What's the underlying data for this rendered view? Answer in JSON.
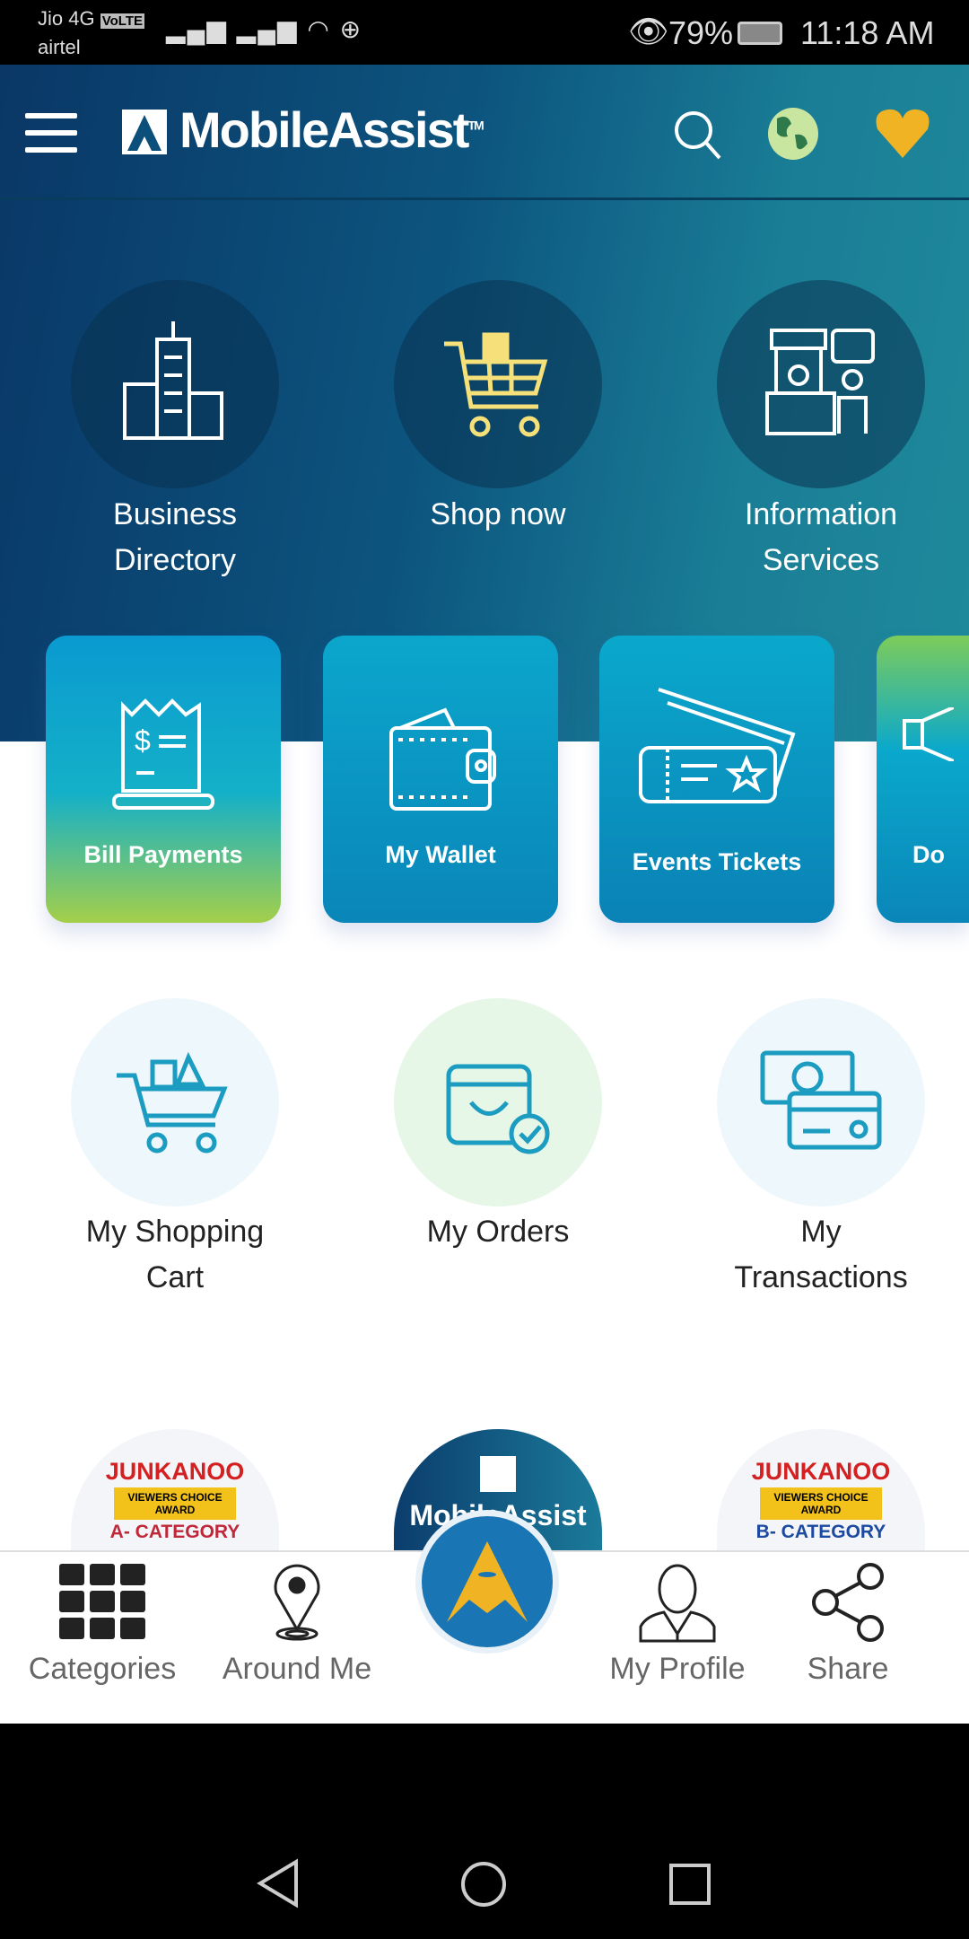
{
  "status_bar": {
    "carrier1": "Jio 4G",
    "volte": "VoLTE",
    "carrier2": "airtel",
    "battery": "79%",
    "time": "11:18 AM"
  },
  "header": {
    "logo": "MobileAssist",
    "tm": "TM"
  },
  "hero_items": [
    {
      "label1": "Business",
      "label2": "Directory",
      "icon": "building-icon"
    },
    {
      "label1": "Shop now",
      "label2": "",
      "icon": "cart-icon"
    },
    {
      "label1": "Information",
      "label2": "Services",
      "icon": "info-desk-icon"
    }
  ],
  "cards": [
    {
      "label": "Bill Payments",
      "icon": "receipt-icon"
    },
    {
      "label": "My Wallet",
      "icon": "wallet-icon"
    },
    {
      "label": "Events Tickets",
      "icon": "tickets-icon"
    },
    {
      "label": "Do",
      "icon": "megaphone-icon"
    }
  ],
  "menu_items": [
    {
      "label1": "My Shopping",
      "label2": "Cart",
      "icon": "shopping-cart-icon"
    },
    {
      "label1": "My Orders",
      "label2": "",
      "icon": "orders-bag-icon"
    },
    {
      "label1": "My",
      "label2": "Transactions",
      "icon": "transactions-icon"
    }
  ],
  "banners": [
    {
      "title": "JUNKANOO",
      "award": "VIEWERS CHOICE AWARD",
      "category": "A- CATEGORY"
    },
    {
      "title": "MobileAssist"
    },
    {
      "title": "JUNKANOO",
      "award": "VIEWERS CHOICE AWARD",
      "category": "B- CATEGORY"
    }
  ],
  "bottom_nav": [
    {
      "label": "Categories",
      "icon": "grid-icon"
    },
    {
      "label": "Around Me",
      "icon": "location-pin-icon"
    },
    {
      "label": "My Profile",
      "icon": "profile-icon"
    },
    {
      "label": "Share",
      "icon": "share-icon"
    }
  ],
  "colors": {
    "accent": "#f0b323",
    "brand_blue": "#1a75b4",
    "hero_dark": "#0a3766"
  }
}
